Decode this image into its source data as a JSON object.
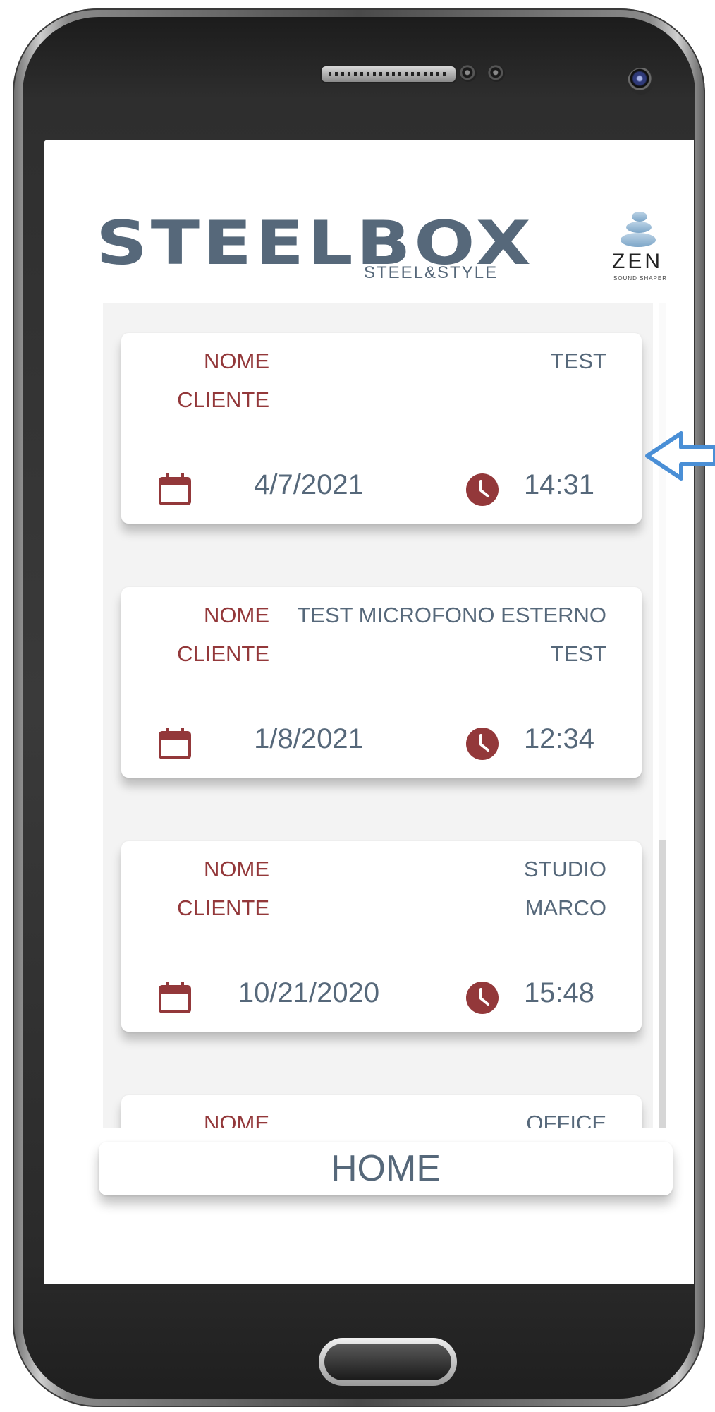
{
  "header": {
    "brand_name": "STEELBOX",
    "brand_tagline": "STEEL&STYLE",
    "partner_name": "ZEN",
    "partner_tagline": "SOUND SHAPER"
  },
  "labels": {
    "name": "NOME",
    "client": "CLIENTE"
  },
  "sessions": [
    {
      "name": "TEST",
      "client": "",
      "date": "4/7/2021",
      "time": "14:31"
    },
    {
      "name": "TEST MICROFONO ESTERNO",
      "client": "TEST",
      "date": "1/8/2021",
      "time": "12:34"
    },
    {
      "name": "STUDIO",
      "client": "MARCO",
      "date": "10/21/2020",
      "time": "15:48"
    },
    {
      "name": "OFFICE",
      "client": "",
      "date": "",
      "time": ""
    }
  ],
  "footer": {
    "home_label": "HOME"
  },
  "colors": {
    "accent": "#93383a",
    "text": "#56687a",
    "list_background": "#f3f3f3",
    "pointer_arrow": "#4a8fd6"
  },
  "icons": {
    "date": "calendar-icon",
    "time": "clock-icon",
    "pointer": "arrow-left-icon"
  }
}
